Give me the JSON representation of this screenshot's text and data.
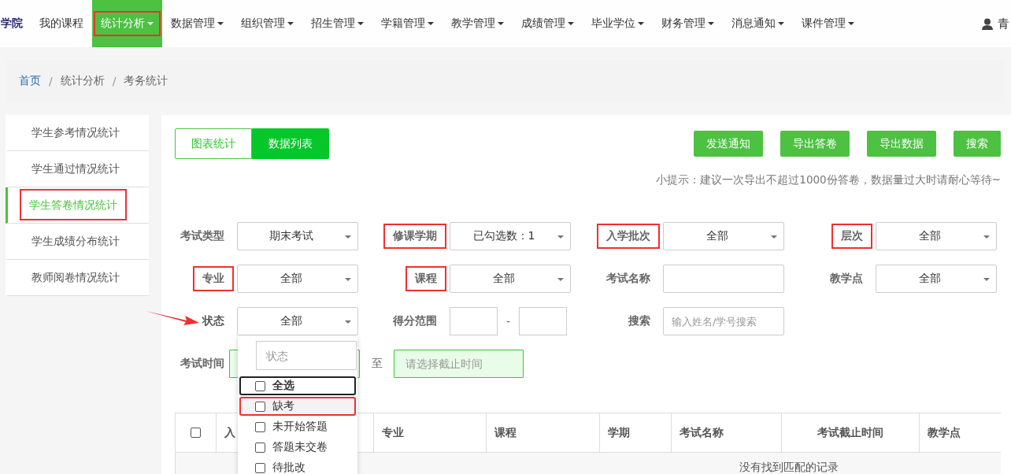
{
  "logo": {
    "text": "学院"
  },
  "nav": [
    {
      "label": "我的课程",
      "dropdown": false,
      "selected": false,
      "marked": false
    },
    {
      "label": "统计分析",
      "dropdown": true,
      "selected": true,
      "marked": true
    },
    {
      "label": "数据管理",
      "dropdown": true,
      "selected": false,
      "marked": false
    },
    {
      "label": "组织管理",
      "dropdown": true,
      "selected": false,
      "marked": false
    },
    {
      "label": "招生管理",
      "dropdown": true,
      "selected": false,
      "marked": false
    },
    {
      "label": "学籍管理",
      "dropdown": true,
      "selected": false,
      "marked": false
    },
    {
      "label": "教学管理",
      "dropdown": true,
      "selected": false,
      "marked": false
    },
    {
      "label": "成绩管理",
      "dropdown": true,
      "selected": false,
      "marked": false
    },
    {
      "label": "毕业学位",
      "dropdown": true,
      "selected": false,
      "marked": false
    },
    {
      "label": "财务管理",
      "dropdown": true,
      "selected": false,
      "marked": false
    },
    {
      "label": "消息通知",
      "dropdown": true,
      "selected": false,
      "marked": false
    },
    {
      "label": "课件管理",
      "dropdown": true,
      "selected": false,
      "marked": false
    }
  ],
  "user": {
    "name": "青"
  },
  "breadcrumb": {
    "separator": "/",
    "items": [
      "首页",
      "统计分析",
      "考务统计"
    ]
  },
  "sidebar": [
    {
      "label": "学生参考情况统计",
      "selected": false,
      "marked": false
    },
    {
      "label": "学生通过情况统计",
      "selected": false,
      "marked": false
    },
    {
      "label": "学生答卷情况统计",
      "selected": true,
      "marked": true
    },
    {
      "label": "学生成绩分布统计",
      "selected": false,
      "marked": false
    },
    {
      "label": "教师阅卷情况统计",
      "selected": false,
      "marked": false
    }
  ],
  "view_tabs": [
    {
      "label": "图表统计",
      "selected": false
    },
    {
      "label": "数据列表",
      "selected": true
    }
  ],
  "actions": [
    "发送通知",
    "导出答卷",
    "导出数据",
    "搜索"
  ],
  "hint": "小提示：建议一次导出不超过1000份答卷，数据量过大时请耐心等待~",
  "filters": [
    {
      "kind": "select",
      "label": "考试类型",
      "value": "期末考试",
      "marked": false,
      "pointed": false
    },
    {
      "kind": "select",
      "label": "修课学期",
      "value": "已勾选数：1",
      "marked": true,
      "pointed": false
    },
    {
      "kind": "select",
      "label": "入学批次",
      "value": "全部",
      "marked": true,
      "pointed": false
    },
    {
      "kind": "select",
      "label": "层次",
      "value": "全部",
      "marked": true,
      "pointed": false
    },
    {
      "kind": "select",
      "label": "专业",
      "value": "全部",
      "marked": true,
      "pointed": false
    },
    {
      "kind": "select",
      "label": "课程",
      "value": "全部",
      "marked": true,
      "pointed": false
    },
    {
      "kind": "text",
      "label": "考试名称",
      "marked": false,
      "pointed": false
    },
    {
      "kind": "select",
      "label": "教学点",
      "value": "全部",
      "marked": false,
      "pointed": false
    },
    {
      "kind": "select",
      "label": "状态",
      "value": "全部",
      "marked": false,
      "pointed": true,
      "expanded": true,
      "search_placeholder": "状态",
      "options": [
        {
          "label": "全选",
          "kind": "all",
          "checked": false,
          "focused": true,
          "hovered": false,
          "marked": false
        },
        {
          "label": "缺考",
          "kind": "option",
          "checked": false,
          "focused": false,
          "hovered": true,
          "marked": true
        },
        {
          "label": "未开始答题",
          "kind": "option",
          "checked": false,
          "focused": false,
          "hovered": false,
          "marked": false
        },
        {
          "label": "答题未交卷",
          "kind": "option",
          "checked": false,
          "focused": false,
          "hovered": false,
          "marked": false
        },
        {
          "label": "待批改",
          "kind": "option",
          "checked": false,
          "focused": false,
          "hovered": false,
          "marked": false
        }
      ]
    },
    {
      "kind": "range",
      "label": "得分范围",
      "separator": "-",
      "marked": false,
      "pointed": false
    },
    {
      "kind": "search",
      "label": "搜索",
      "placeholder": "输入姓名/学号搜索",
      "marked": false,
      "pointed": false
    },
    {
      "kind": "daterange",
      "label": "考试时间",
      "separator": "至",
      "end_placeholder": "请选择截止时间",
      "marked": false,
      "pointed": false
    }
  ],
  "table": {
    "select_all_checked": false,
    "columns": [
      "入",
      "专业",
      "课程",
      "学期",
      "考试名称",
      "考试截止时间",
      "教学点"
    ],
    "empty_text": "没有找到匹配的记录"
  }
}
